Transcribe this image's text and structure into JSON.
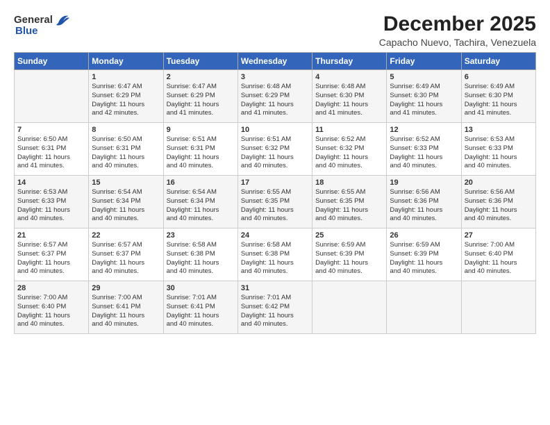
{
  "logo": {
    "general": "General",
    "blue": "Blue"
  },
  "title": "December 2025",
  "location": "Capacho Nuevo, Tachira, Venezuela",
  "header_days": [
    "Sunday",
    "Monday",
    "Tuesday",
    "Wednesday",
    "Thursday",
    "Friday",
    "Saturday"
  ],
  "weeks": [
    [
      {
        "day": "",
        "text": ""
      },
      {
        "day": "1",
        "text": "Sunrise: 6:47 AM\nSunset: 6:29 PM\nDaylight: 11 hours\nand 42 minutes."
      },
      {
        "day": "2",
        "text": "Sunrise: 6:47 AM\nSunset: 6:29 PM\nDaylight: 11 hours\nand 41 minutes."
      },
      {
        "day": "3",
        "text": "Sunrise: 6:48 AM\nSunset: 6:29 PM\nDaylight: 11 hours\nand 41 minutes."
      },
      {
        "day": "4",
        "text": "Sunrise: 6:48 AM\nSunset: 6:30 PM\nDaylight: 11 hours\nand 41 minutes."
      },
      {
        "day": "5",
        "text": "Sunrise: 6:49 AM\nSunset: 6:30 PM\nDaylight: 11 hours\nand 41 minutes."
      },
      {
        "day": "6",
        "text": "Sunrise: 6:49 AM\nSunset: 6:30 PM\nDaylight: 11 hours\nand 41 minutes."
      }
    ],
    [
      {
        "day": "7",
        "text": "Sunrise: 6:50 AM\nSunset: 6:31 PM\nDaylight: 11 hours\nand 41 minutes."
      },
      {
        "day": "8",
        "text": "Sunrise: 6:50 AM\nSunset: 6:31 PM\nDaylight: 11 hours\nand 40 minutes."
      },
      {
        "day": "9",
        "text": "Sunrise: 6:51 AM\nSunset: 6:31 PM\nDaylight: 11 hours\nand 40 minutes."
      },
      {
        "day": "10",
        "text": "Sunrise: 6:51 AM\nSunset: 6:32 PM\nDaylight: 11 hours\nand 40 minutes."
      },
      {
        "day": "11",
        "text": "Sunrise: 6:52 AM\nSunset: 6:32 PM\nDaylight: 11 hours\nand 40 minutes."
      },
      {
        "day": "12",
        "text": "Sunrise: 6:52 AM\nSunset: 6:33 PM\nDaylight: 11 hours\nand 40 minutes."
      },
      {
        "day": "13",
        "text": "Sunrise: 6:53 AM\nSunset: 6:33 PM\nDaylight: 11 hours\nand 40 minutes."
      }
    ],
    [
      {
        "day": "14",
        "text": "Sunrise: 6:53 AM\nSunset: 6:33 PM\nDaylight: 11 hours\nand 40 minutes."
      },
      {
        "day": "15",
        "text": "Sunrise: 6:54 AM\nSunset: 6:34 PM\nDaylight: 11 hours\nand 40 minutes."
      },
      {
        "day": "16",
        "text": "Sunrise: 6:54 AM\nSunset: 6:34 PM\nDaylight: 11 hours\nand 40 minutes."
      },
      {
        "day": "17",
        "text": "Sunrise: 6:55 AM\nSunset: 6:35 PM\nDaylight: 11 hours\nand 40 minutes."
      },
      {
        "day": "18",
        "text": "Sunrise: 6:55 AM\nSunset: 6:35 PM\nDaylight: 11 hours\nand 40 minutes."
      },
      {
        "day": "19",
        "text": "Sunrise: 6:56 AM\nSunset: 6:36 PM\nDaylight: 11 hours\nand 40 minutes."
      },
      {
        "day": "20",
        "text": "Sunrise: 6:56 AM\nSunset: 6:36 PM\nDaylight: 11 hours\nand 40 minutes."
      }
    ],
    [
      {
        "day": "21",
        "text": "Sunrise: 6:57 AM\nSunset: 6:37 PM\nDaylight: 11 hours\nand 40 minutes."
      },
      {
        "day": "22",
        "text": "Sunrise: 6:57 AM\nSunset: 6:37 PM\nDaylight: 11 hours\nand 40 minutes."
      },
      {
        "day": "23",
        "text": "Sunrise: 6:58 AM\nSunset: 6:38 PM\nDaylight: 11 hours\nand 40 minutes."
      },
      {
        "day": "24",
        "text": "Sunrise: 6:58 AM\nSunset: 6:38 PM\nDaylight: 11 hours\nand 40 minutes."
      },
      {
        "day": "25",
        "text": "Sunrise: 6:59 AM\nSunset: 6:39 PM\nDaylight: 11 hours\nand 40 minutes."
      },
      {
        "day": "26",
        "text": "Sunrise: 6:59 AM\nSunset: 6:39 PM\nDaylight: 11 hours\nand 40 minutes."
      },
      {
        "day": "27",
        "text": "Sunrise: 7:00 AM\nSunset: 6:40 PM\nDaylight: 11 hours\nand 40 minutes."
      }
    ],
    [
      {
        "day": "28",
        "text": "Sunrise: 7:00 AM\nSunset: 6:40 PM\nDaylight: 11 hours\nand 40 minutes."
      },
      {
        "day": "29",
        "text": "Sunrise: 7:00 AM\nSunset: 6:41 PM\nDaylight: 11 hours\nand 40 minutes."
      },
      {
        "day": "30",
        "text": "Sunrise: 7:01 AM\nSunset: 6:41 PM\nDaylight: 11 hours\nand 40 minutes."
      },
      {
        "day": "31",
        "text": "Sunrise: 7:01 AM\nSunset: 6:42 PM\nDaylight: 11 hours\nand 40 minutes."
      },
      {
        "day": "",
        "text": ""
      },
      {
        "day": "",
        "text": ""
      },
      {
        "day": "",
        "text": ""
      }
    ]
  ]
}
